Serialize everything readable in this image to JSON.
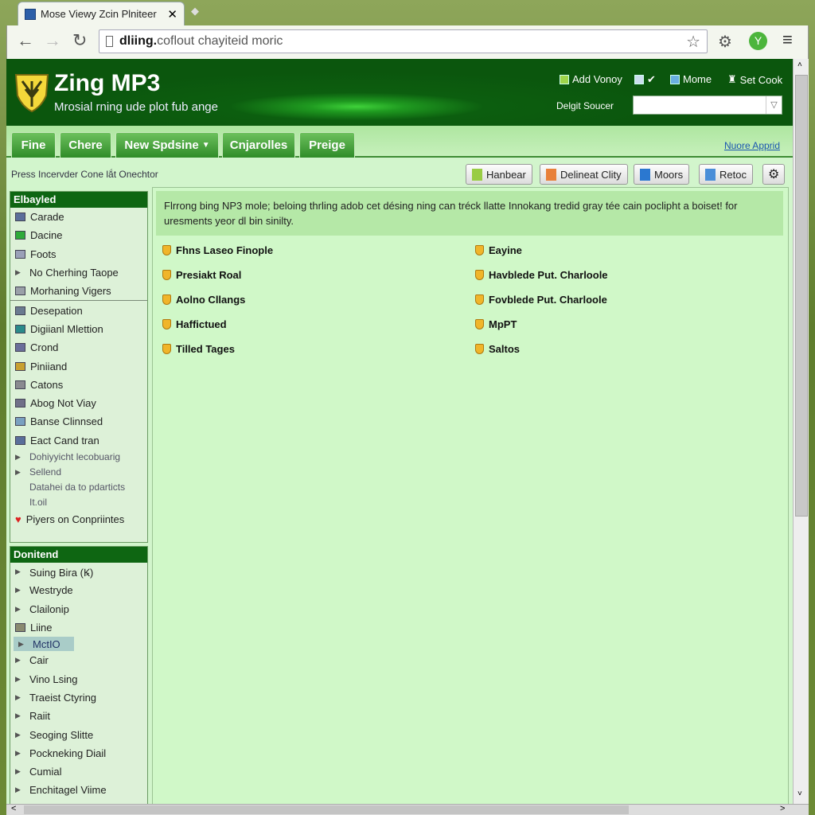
{
  "browser": {
    "tab_title": "Mose Viewy Zcin Plniteer",
    "address_domain": "dliing.",
    "address_rest": "coflout chayiteid moric"
  },
  "header": {
    "title": "Zing MP3",
    "subtitle": "Mrosial rning ude plot fub ange",
    "links": [
      "Add Vonoy",
      "Mome",
      "Set Cook"
    ],
    "search_label": "Delgit Soucer",
    "search_value": ""
  },
  "nav": {
    "tabs": [
      "Fine",
      "Chere",
      "New Spdsine",
      "Cnjarolles",
      "Preige"
    ],
    "right_link": "Nuore Apprid"
  },
  "toolbar": {
    "breadcrumb": "Press Incervder Cone lắt Onechtor",
    "buttons": [
      "Hanbear",
      "Delineat Clity",
      "Moors",
      "Retoc"
    ]
  },
  "sidebar": {
    "panel1_title": "Elbayled",
    "panel1_items": [
      "Carade",
      "Dacine",
      "Foots",
      "No Cherhing Taope",
      "Morhaning Vigers"
    ],
    "panel1_items_b": [
      "Desepation",
      "Digiianl Mlettion",
      "Crond",
      "Piniiand",
      "Catons",
      "Abog Not Viay",
      "Banse Clinnsed",
      "Eact Cand tran"
    ],
    "panel1_small": [
      "Dohiyyicht lecobuarig",
      "Sellend",
      "Datahei da to pdarticts",
      "It.oil"
    ],
    "panel1_last": "Piyers on Conpriintes",
    "panel2_title": "Donitend",
    "panel2_items": [
      "Suing Bira (Ꝃ)",
      "Westryde",
      "Clailonip",
      "Liine",
      "MctIO",
      "Cair",
      "Vino Lsing",
      "Traeist Ctyring",
      "Raiit",
      "Seoging Slitte",
      "Pockneking Diail",
      "Cumial",
      "Enchitagel Viime"
    ],
    "selected": "MctIO"
  },
  "main": {
    "info": "Flrrong bing NP3 mole; beloing thrling adob cet désing ning can tréck llatte Innokang tredid gray tée cain poclipht a boiset! for uresments yeor dl bin sinilty.",
    "left_items": [
      "Fhns Laseo Finople",
      "Presiakt Roal",
      "Aolno Cllangs",
      "Haffictued",
      "Tilled Tages"
    ],
    "right_items": [
      "Eayine",
      "Havblede Put. Charloole",
      "Fovblede Put. Charloole",
      "MpPT",
      "Saltos"
    ]
  },
  "colors": {
    "header": "#0b560d",
    "accent": "#2f8c28",
    "page": "#d2f5cc"
  }
}
